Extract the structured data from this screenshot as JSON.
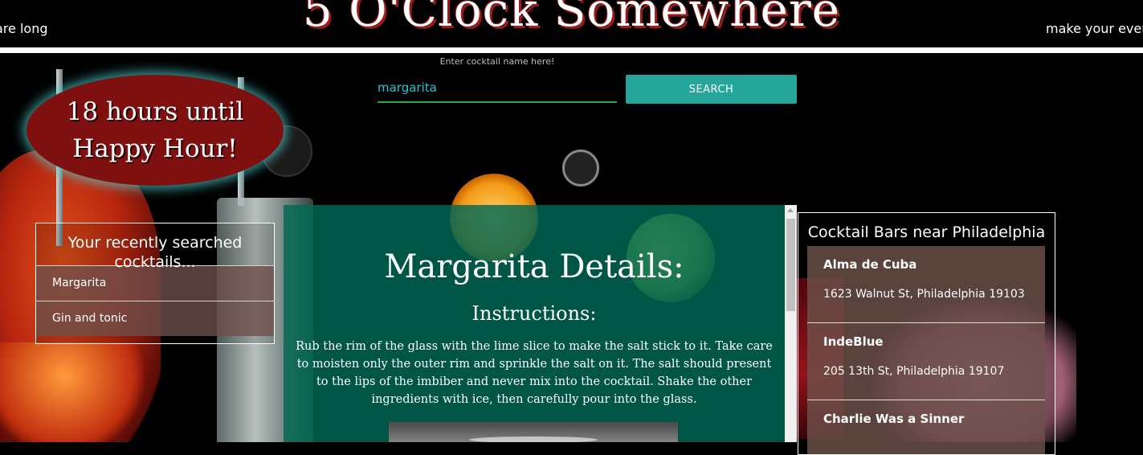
{
  "header": {
    "site_title": "5 O'Clock Somewhere",
    "marquee_left": "are long",
    "marquee_right": "make your eveni"
  },
  "search": {
    "hint": "Enter cocktail name here!",
    "value": "margarita",
    "button_label": "SEARCH"
  },
  "happy_hour": {
    "line1": "18 hours until",
    "line2": "Happy Hour!"
  },
  "recent": {
    "title": "Your recently searched cocktails...",
    "items": [
      {
        "label": "Margarita"
      },
      {
        "label": "Gin and tonic"
      }
    ]
  },
  "details": {
    "title": "Margarita Details:",
    "instructions_heading": "Instructions:",
    "instructions": "Rub the rim of the glass with the lime slice to make the salt stick to it. Take care to moisten only the outer rim and sprinkle the salt on it. The salt should present to the lips of the imbiber and never mix into the cocktail. Shake the other ingredients with ice, then carefully pour into the glass."
  },
  "bars": {
    "title": "Cocktail Bars near Philadelphia",
    "items": [
      {
        "name": "Alma de Cuba",
        "address": "1623 Walnut St, Philadelphia 19103"
      },
      {
        "name": "IndeBlue",
        "address": "205 13th St, Philadelphia 19107"
      },
      {
        "name": "Charlie Was a Sinner",
        "address": ""
      }
    ]
  },
  "colors": {
    "search_button": "#26a69a",
    "badge": "#7e1010",
    "details_panel": "#00695a",
    "list_item": "#6e504b"
  }
}
